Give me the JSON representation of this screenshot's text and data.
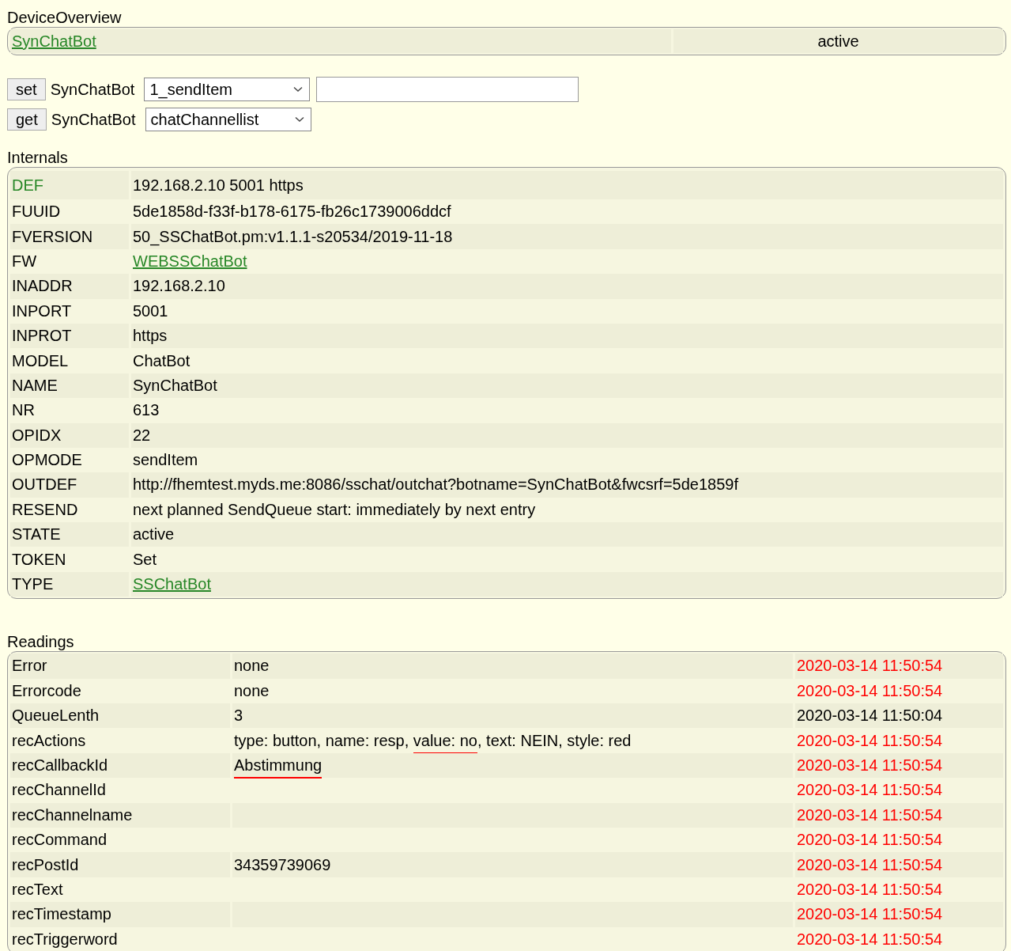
{
  "overview": {
    "title": "DeviceOverview",
    "device": "SynChatBot",
    "state": "active"
  },
  "commands": [
    {
      "button": "set",
      "device": "SynChatBot",
      "option": "1_sendItem",
      "has_input": true
    },
    {
      "button": "get",
      "device": "SynChatBot",
      "option": "chatChannellist",
      "has_input": false
    }
  ],
  "internals": {
    "title": "Internals",
    "rows": [
      {
        "name": "DEF",
        "value": "192.168.2.10 5001 https",
        "name_link": true,
        "value_link": false
      },
      {
        "name": "FUUID",
        "value": "5de1858d-f33f-b178-6175-fb26c1739006ddcf",
        "name_link": false,
        "value_link": false
      },
      {
        "name": "FVERSION",
        "value": "50_SSChatBot.pm:v1.1.1-s20534/2019-11-18",
        "name_link": false,
        "value_link": false
      },
      {
        "name": "FW",
        "value": "WEBSSChatBot",
        "name_link": false,
        "value_link": true
      },
      {
        "name": "INADDR",
        "value": "192.168.2.10",
        "name_link": false,
        "value_link": false
      },
      {
        "name": "INPORT",
        "value": "5001",
        "name_link": false,
        "value_link": false
      },
      {
        "name": "INPROT",
        "value": "https",
        "name_link": false,
        "value_link": false
      },
      {
        "name": "MODEL",
        "value": "ChatBot",
        "name_link": false,
        "value_link": false
      },
      {
        "name": "NAME",
        "value": "SynChatBot",
        "name_link": false,
        "value_link": false
      },
      {
        "name": "NR",
        "value": "613",
        "name_link": false,
        "value_link": false
      },
      {
        "name": "OPIDX",
        "value": "22",
        "name_link": false,
        "value_link": false
      },
      {
        "name": "OPMODE",
        "value": "sendItem",
        "name_link": false,
        "value_link": false
      },
      {
        "name": "OUTDEF",
        "value": "http://fhemtest.myds.me:8086/sschat/outchat?botname=SynChatBot&fwcsrf=5de1859f",
        "name_link": false,
        "value_link": false
      },
      {
        "name": "RESEND",
        "value": "next planned SendQueue start: immediately by next entry",
        "name_link": false,
        "value_link": false
      },
      {
        "name": "STATE",
        "value": "active",
        "name_link": false,
        "value_link": false
      },
      {
        "name": "TOKEN",
        "value": "Set",
        "name_link": false,
        "value_link": false
      },
      {
        "name": "TYPE",
        "value": "SSChatBot",
        "name_link": false,
        "value_link": true
      }
    ]
  },
  "readings": {
    "title": "Readings",
    "rows": [
      {
        "name": "Error",
        "value": [
          {
            "text": "none",
            "marked": false
          }
        ],
        "time": "2020-03-14 11:50:54",
        "recent": true
      },
      {
        "name": "Errorcode",
        "value": [
          {
            "text": "none",
            "marked": false
          }
        ],
        "time": "2020-03-14 11:50:54",
        "recent": true
      },
      {
        "name": "QueueLenth",
        "value": [
          {
            "text": "3",
            "marked": false
          }
        ],
        "time": "2020-03-14 11:50:04",
        "recent": false
      },
      {
        "name": "recActions",
        "value": [
          {
            "text": "type: button, name: resp, ",
            "marked": false
          },
          {
            "text": "value: no",
            "marked": true
          },
          {
            "text": ", text: NEIN, style: red",
            "marked": false
          }
        ],
        "time": "2020-03-14 11:50:54",
        "recent": true
      },
      {
        "name": "recCallbackId",
        "value": [
          {
            "text": "Abstimmung",
            "marked": true
          }
        ],
        "time": "2020-03-14 11:50:54",
        "recent": true
      },
      {
        "name": "recChannelId",
        "value": [],
        "time": "2020-03-14 11:50:54",
        "recent": true
      },
      {
        "name": "recChannelname",
        "value": [],
        "time": "2020-03-14 11:50:54",
        "recent": true
      },
      {
        "name": "recCommand",
        "value": [],
        "time": "2020-03-14 11:50:54",
        "recent": true
      },
      {
        "name": "recPostId",
        "value": [
          {
            "text": "34359739069",
            "marked": false
          }
        ],
        "time": "2020-03-14 11:50:54",
        "recent": true
      },
      {
        "name": "recText",
        "value": [],
        "time": "2020-03-14 11:50:54",
        "recent": true
      },
      {
        "name": "recTimestamp",
        "value": [],
        "time": "2020-03-14 11:50:54",
        "recent": true
      },
      {
        "name": "recTriggerword",
        "value": [],
        "time": "2020-03-14 11:50:54",
        "recent": true
      }
    ]
  }
}
